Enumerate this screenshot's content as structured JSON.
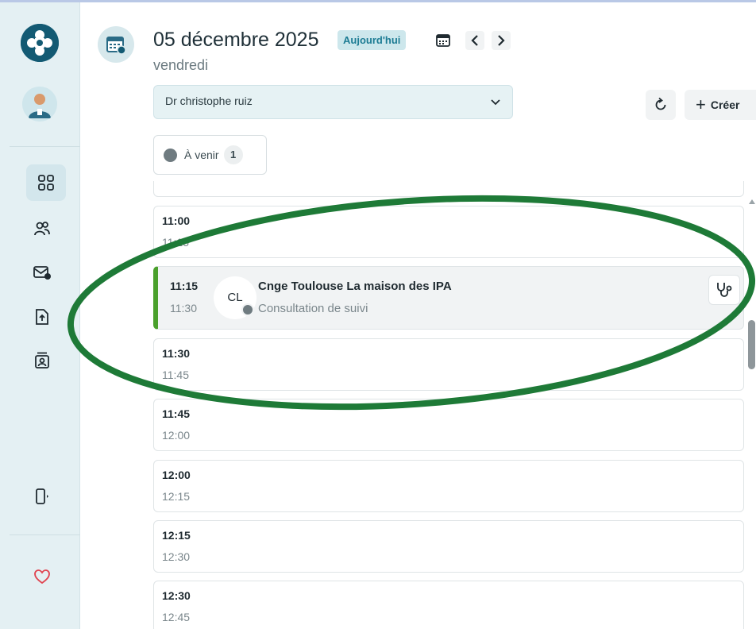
{
  "header": {
    "date": "05 décembre 2025",
    "today_label": "Aujourd'hui",
    "weekday": "vendredi"
  },
  "doctor_select": {
    "value": "Dr christophe ruiz"
  },
  "actions": {
    "create_label": "Créer"
  },
  "filter": {
    "label": "À venir",
    "count": "1"
  },
  "slots": [
    {
      "start": "11:00",
      "end": "11:15"
    },
    {
      "start": "11:15",
      "end": "11:30",
      "initials": "CL",
      "title": "Cnge Toulouse La maison des IPA",
      "type": "Consultation de suivi"
    },
    {
      "start": "11:30",
      "end": "11:45"
    },
    {
      "start": "11:45",
      "end": "12:00"
    },
    {
      "start": "12:00",
      "end": "12:15"
    },
    {
      "start": "12:15",
      "end": "12:30"
    },
    {
      "start": "12:30",
      "end": "12:45"
    }
  ],
  "sidebar": {
    "icons": [
      "app-logo-icon",
      "doctor-avatar-icon",
      "dashboard-icon",
      "patients-icon",
      "mail-icon",
      "upload-document-icon",
      "contacts-icon",
      "logout-icon",
      "favorite-heart-icon"
    ]
  },
  "colors": {
    "accent": "#135a73",
    "appointment_bar": "#4aa02c",
    "annotation": "#1e7a37",
    "badge_text": "#1d7c94"
  }
}
